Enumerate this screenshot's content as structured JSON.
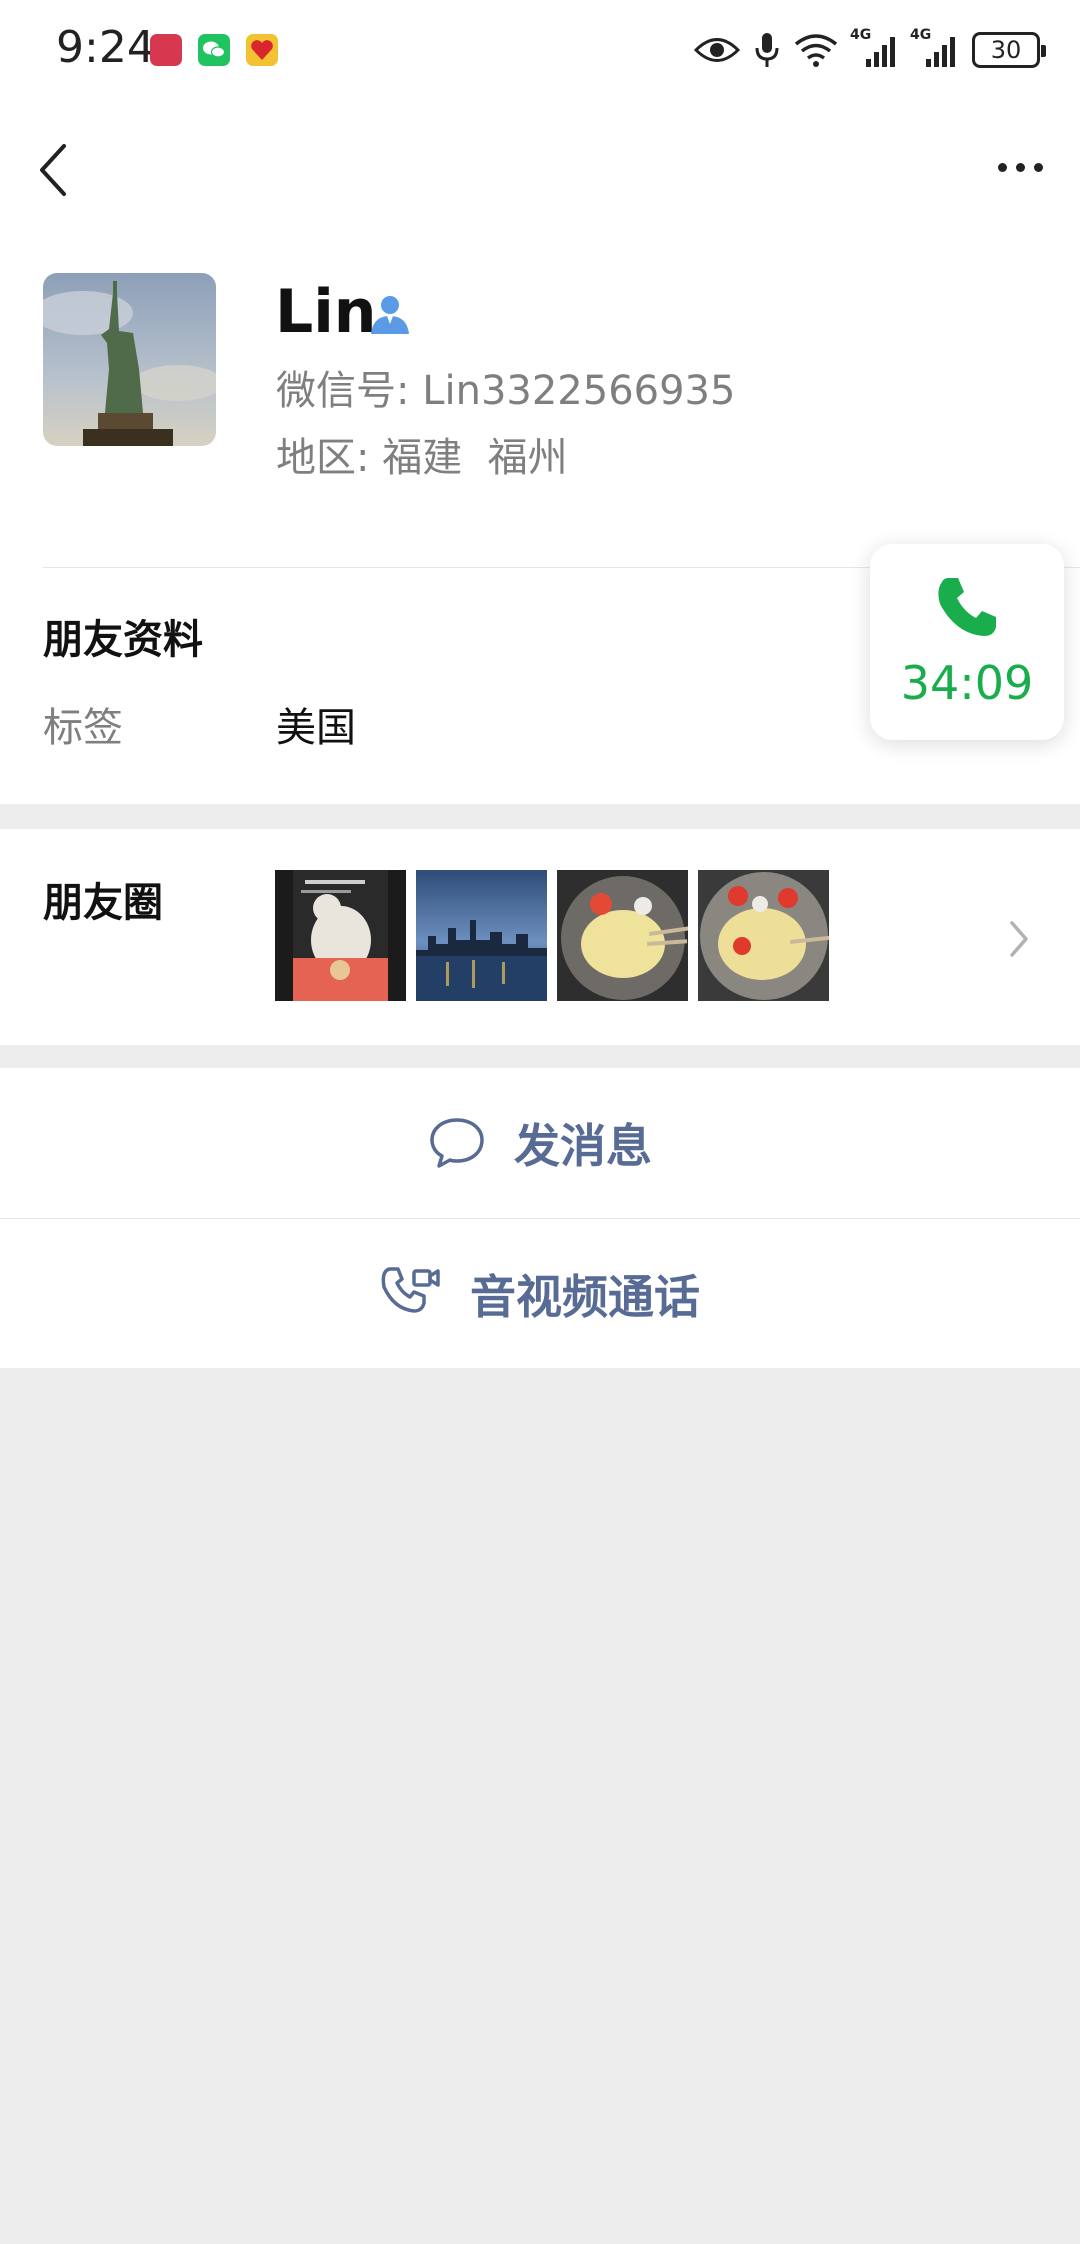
{
  "status_bar": {
    "time": "9:24",
    "app_icons": [
      "huawei-app-icon",
      "wechat-icon",
      "red-heart-app-icon"
    ],
    "network_label_1": "4G",
    "network_label_2": "4G",
    "battery": "30"
  },
  "nav": {
    "back_icon": "chevron-left-icon",
    "more_icon": "more-dots-icon"
  },
  "profile": {
    "name": "Lin",
    "wechat_id_label": "微信号:",
    "wechat_id": "Lin3322566935",
    "region_label": "地区:",
    "region": "福建  福州"
  },
  "friend_info": {
    "title": "朋友资料",
    "tag_label": "标签",
    "tag_value": "美国"
  },
  "call_widget": {
    "icon": "phone-icon",
    "duration": "34:09",
    "color": "#1aad4c"
  },
  "moments": {
    "title": "朋友圈"
  },
  "actions": {
    "message": "发消息",
    "video_call": "音视频通话",
    "link_color": "#576b95"
  }
}
